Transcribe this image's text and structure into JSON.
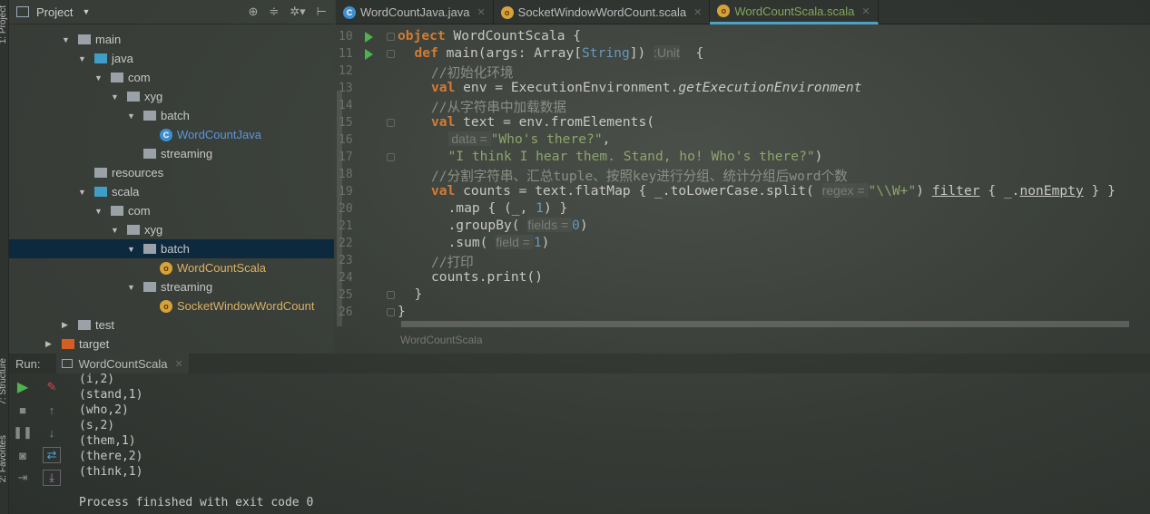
{
  "side_tabs": {
    "project": "1: Project",
    "structure": "7: Structure",
    "favorites": "2: Favorites"
  },
  "project_panel": {
    "title": "Project",
    "tree": [
      {
        "label": "main",
        "kind": "folder",
        "depth": 0,
        "expanded": true
      },
      {
        "label": "java",
        "kind": "src",
        "depth": 1,
        "expanded": true
      },
      {
        "label": "com",
        "kind": "package",
        "depth": 2,
        "expanded": true
      },
      {
        "label": "xyg",
        "kind": "package",
        "depth": 3,
        "expanded": true
      },
      {
        "label": "batch",
        "kind": "package",
        "depth": 4,
        "expanded": true
      },
      {
        "label": "WordCountJava",
        "kind": "java-class",
        "depth": 5
      },
      {
        "label": "streaming",
        "kind": "package",
        "depth": 4
      },
      {
        "label": "resources",
        "kind": "res",
        "depth": 1
      },
      {
        "label": "scala",
        "kind": "src",
        "depth": 1,
        "expanded": true
      },
      {
        "label": "com",
        "kind": "package",
        "depth": 2,
        "expanded": true
      },
      {
        "label": "xyg",
        "kind": "package",
        "depth": 3,
        "expanded": true
      },
      {
        "label": "batch",
        "kind": "package",
        "depth": 4,
        "expanded": true,
        "selected": true
      },
      {
        "label": "WordCountScala",
        "kind": "scala-object",
        "depth": 5
      },
      {
        "label": "streaming",
        "kind": "package",
        "depth": 4,
        "expanded": true
      },
      {
        "label": "SocketWindowWordCount",
        "kind": "scala-object",
        "depth": 5
      },
      {
        "label": "test",
        "kind": "folder",
        "depth": 0,
        "expanded": false
      },
      {
        "label": "target",
        "kind": "target",
        "depth": -1,
        "expanded": false
      }
    ]
  },
  "tabs": [
    {
      "label": "WordCountJava.java",
      "icon": "java-class-icon"
    },
    {
      "label": "SocketWindowWordCount.scala",
      "icon": "scala-object-icon"
    },
    {
      "label": "WordCountScala.scala",
      "icon": "scala-object-icon",
      "active": true
    }
  ],
  "editor": {
    "lines": [
      {
        "n": "10",
        "run": true,
        "fold": true,
        "indent": 0,
        "tokens": [
          [
            "object",
            "kw"
          ],
          [
            " WordCountScala {",
            ""
          ]
        ]
      },
      {
        "n": "11",
        "run": true,
        "fold": true,
        "indent": 1,
        "tokens": [
          [
            "def",
            "kw"
          ],
          [
            " main(args: Array[",
            ""
          ],
          [
            "String",
            "num"
          ],
          [
            "]) ",
            ""
          ],
          [
            ":Unit",
            "hint"
          ],
          [
            "  {",
            ""
          ]
        ]
      },
      {
        "n": "12",
        "indent": 2,
        "tokens": [
          [
            "//初始化环境",
            "cm"
          ]
        ]
      },
      {
        "n": "13",
        "indent": 2,
        "tokens": [
          [
            "val",
            "kw"
          ],
          [
            " env = ExecutionEnvironment.",
            ""
          ],
          [
            "getExecutionEnvironment",
            "it"
          ]
        ]
      },
      {
        "n": "14",
        "indent": 2,
        "tokens": [
          [
            "//从字符串中加载数据",
            "cm"
          ]
        ]
      },
      {
        "n": "15",
        "fold": true,
        "indent": 2,
        "tokens": [
          [
            "val",
            "kw"
          ],
          [
            " text = env.fromElements(",
            ""
          ]
        ]
      },
      {
        "n": "16",
        "indent": 3,
        "tokens": [
          [
            " data = ",
            "hint"
          ],
          [
            "\"Who's there?\"",
            "str"
          ],
          [
            ",",
            ""
          ]
        ]
      },
      {
        "n": "17",
        "fold": true,
        "indent": 3,
        "tokens": [
          [
            "\"I think I hear them. Stand, ho! Who's there?\"",
            "str"
          ],
          [
            ")",
            ""
          ]
        ]
      },
      {
        "n": "18",
        "indent": 2,
        "tokens": [
          [
            "//分割字符串、汇总tuple、按照key进行分组、统计分组后word个数",
            "cm"
          ]
        ]
      },
      {
        "n": "19",
        "indent": 2,
        "tokens": [
          [
            "val",
            "kw"
          ],
          [
            " counts = text.flatMap { _.toLowerCase.split( ",
            ""
          ],
          [
            "regex = ",
            "hint"
          ],
          [
            "\"\\\\W+\"",
            "str"
          ],
          [
            ") ",
            ""
          ],
          [
            "filter",
            "ul"
          ],
          [
            " { _.",
            ""
          ],
          [
            "nonEmpty",
            "ul"
          ],
          [
            " } }",
            ""
          ]
        ]
      },
      {
        "n": "20",
        "indent": 3,
        "tokens": [
          [
            ".map { (_, ",
            ""
          ],
          [
            "1",
            "num"
          ],
          [
            ") }",
            ""
          ]
        ]
      },
      {
        "n": "21",
        "indent": 3,
        "tokens": [
          [
            ".groupBy( ",
            ""
          ],
          [
            "fields = ",
            "hint"
          ],
          [
            "0",
            "num"
          ],
          [
            ")",
            ""
          ]
        ]
      },
      {
        "n": "22",
        "indent": 3,
        "tokens": [
          [
            ".sum( ",
            ""
          ],
          [
            "field = ",
            "hint"
          ],
          [
            "1",
            "num"
          ],
          [
            ")",
            ""
          ]
        ]
      },
      {
        "n": "23",
        "indent": 2,
        "tokens": [
          [
            "//打印",
            "cm"
          ]
        ]
      },
      {
        "n": "24",
        "indent": 2,
        "tokens": [
          [
            "counts.print()",
            ""
          ]
        ]
      },
      {
        "n": "25",
        "fold": true,
        "indent": 1,
        "tokens": [
          [
            "}",
            ""
          ]
        ]
      },
      {
        "n": "26",
        "fold": true,
        "indent": 0,
        "tokens": [
          [
            "}",
            ""
          ]
        ]
      }
    ],
    "breadcrumb": "WordCountScala"
  },
  "run": {
    "label": "Run:",
    "tab": "WordCountScala",
    "output": [
      "(i,2)",
      "(stand,1)",
      "(who,2)",
      "(s,2)",
      "(them,1)",
      "(there,2)",
      "(think,1)",
      "",
      "Process finished with exit code 0"
    ]
  }
}
